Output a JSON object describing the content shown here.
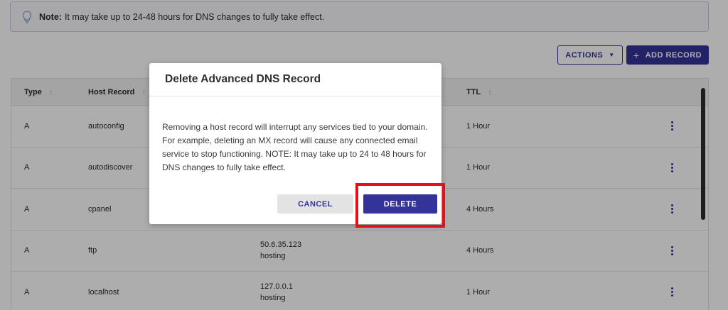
{
  "notice": {
    "bold": "Note:",
    "text": "It may take up to 24-48 hours for DNS changes to fully take effect."
  },
  "toolbar": {
    "actions_label": "ACTIONS",
    "add_label": "ADD RECORD"
  },
  "table": {
    "headers": {
      "type": "Type",
      "host": "Host Record",
      "ttl": "TTL"
    },
    "rows": [
      {
        "type": "A",
        "host": "autoconfig",
        "value": "",
        "value2": "",
        "ttl": "1 Hour"
      },
      {
        "type": "A",
        "host": "autodiscover",
        "value": "",
        "value2": "",
        "ttl": "1 Hour"
      },
      {
        "type": "A",
        "host": "cpanel",
        "value": "",
        "value2": "",
        "ttl": "4 Hours"
      },
      {
        "type": "A",
        "host": "ftp",
        "value": "50.6.35.123",
        "value2": "hosting",
        "ttl": "4 Hours"
      },
      {
        "type": "A",
        "host": "localhost",
        "value": "127.0.0.1",
        "value2": "hosting",
        "ttl": "1 Hour"
      }
    ]
  },
  "modal": {
    "title": "Delete Advanced DNS Record",
    "body": "Removing a host record will interrupt any services tied to your domain. For example, deleting an MX record will cause any connected email service to stop functioning. NOTE: It may take up to 24 to 48 hours for DNS changes to fully take effect.",
    "cancel_label": "CANCEL",
    "delete_label": "DELETE"
  },
  "colors": {
    "primary": "#34339a",
    "highlight": "#e3111a",
    "overlay": "rgba(0,0,0,0.32)"
  }
}
